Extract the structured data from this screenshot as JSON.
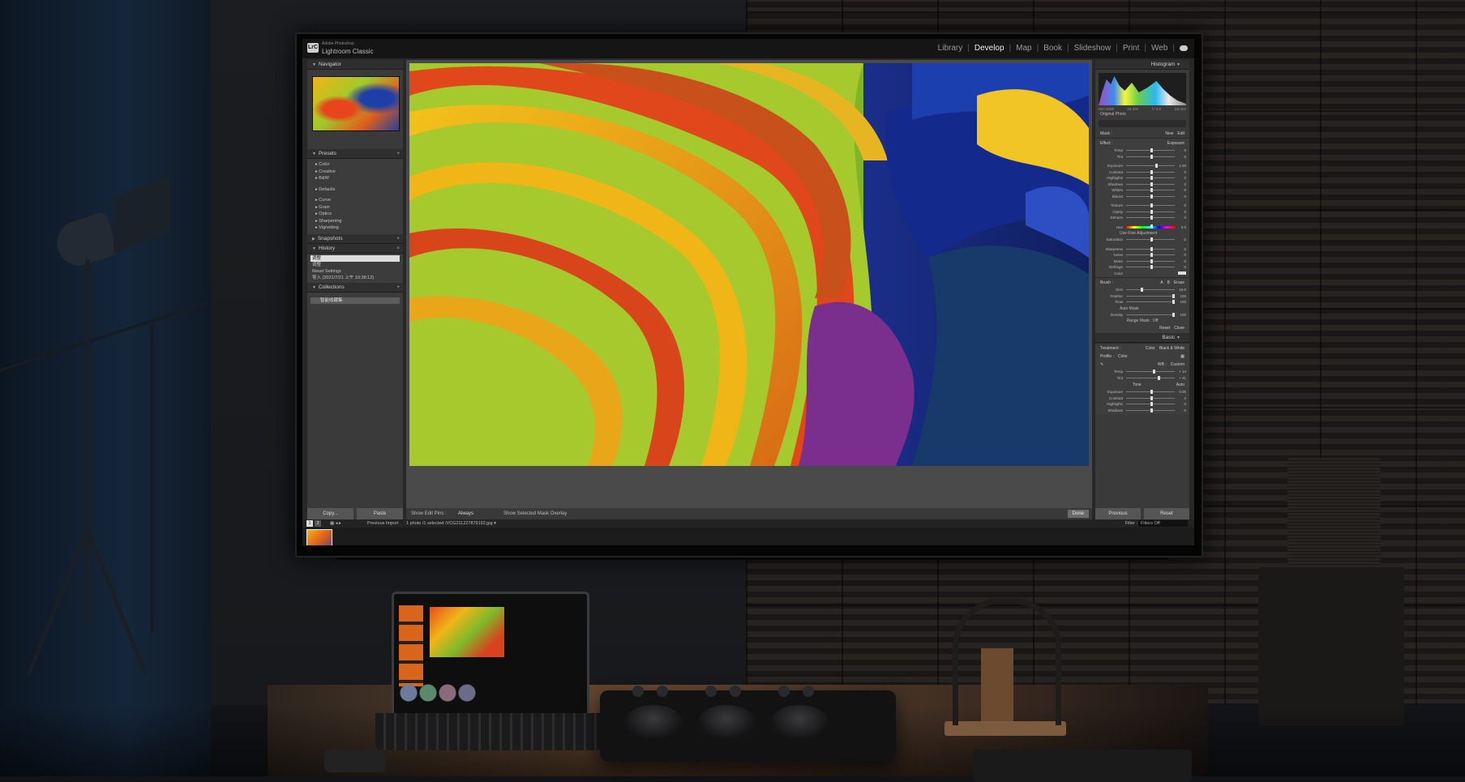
{
  "app": {
    "brand": "Adobe Photoshop",
    "name": "Lightroom Classic",
    "logo": "LrC"
  },
  "modules": [
    "Library",
    "Develop",
    "Map",
    "Book",
    "Slideshow",
    "Print",
    "Web"
  ],
  "active_module": "Develop",
  "left_panel": {
    "navigator": "Navigator",
    "presets": "Presets",
    "preset_items": [
      "Color",
      "Creative",
      "B&W",
      "Defaults",
      "Curve",
      "Grain",
      "Optics",
      "Sharpening",
      "Vignetting"
    ],
    "snapshots": "Snapshots",
    "history": "History",
    "history_items": [
      "调整",
      "调整",
      "Reset Settings",
      "导入 (2021/7/21 上午 10:38:12)"
    ],
    "collections": "Collections",
    "collection_items": [
      "智能收藏集"
    ],
    "copy_button": "Copy...",
    "paste_button": "Paste"
  },
  "center": {
    "toolbar_show_edit_pins": "Show Edit Pins :",
    "toolbar_pins_value": "Always",
    "toolbar_overlay": "Show Selected Mask Overlay",
    "done_button": "Done"
  },
  "right_panel": {
    "histogram": "Histogram",
    "histogram_info": [
      "ISO 2000",
      "24 mm",
      "f / 2.8",
      "1/6 sec"
    ],
    "original_photo": "Original Photo",
    "mask_label": "Mask :",
    "mask_new": "New",
    "mask_edit": "Edit",
    "effect_label": "Effect :",
    "effect_value": "Exposure",
    "sliders_a": [
      "Temp",
      "Tint"
    ],
    "sliders_b": [
      "Exposure",
      "Contrast",
      "Highlights",
      "Shadows",
      "Whites",
      "Blacks"
    ],
    "sliders_c": [
      "Texture",
      "Clarity",
      "Dehaze"
    ],
    "hue_label": "Hue",
    "hue_value": "0.0",
    "fine_adjust": "Use Fine Adjustment",
    "saturation": "Saturation",
    "sliders_d": [
      "Sharpness",
      "Noise",
      "Moire",
      "Defringe"
    ],
    "color_label": "Color",
    "brush_label": "Brush :",
    "brush_a": "A",
    "brush_b": "B",
    "brush_erase": "Erase",
    "brush_sliders": [
      "Size",
      "Feather",
      "Flow"
    ],
    "brush_values": [
      "15.0",
      "100",
      "100"
    ],
    "auto_mask": "Auto Mask",
    "density": "Density",
    "density_value": "100",
    "range_mask": "Range Mask : Off",
    "reset": "Reset",
    "close": "Close",
    "basic": "Basic",
    "treatment": "Treatment :",
    "treatment_color": "Color",
    "treatment_bw": "Black & White",
    "profile": "Profile :",
    "profile_value": "Color",
    "wb": "WB :",
    "wb_value": "Custom",
    "temp_tint_values": [
      "+ 14",
      "+ 41"
    ],
    "tone": "Tone",
    "tone_auto": "Auto",
    "tone_sliders": [
      "Exposure",
      "Contrast",
      "Highlights",
      "Shadows"
    ],
    "exposure_value": "0.00",
    "previous_button": "Previous",
    "reset_button": "Reset"
  },
  "filmstrip": {
    "page1": "1",
    "page2": "2",
    "source": "Previous Import",
    "selection": "1 photo /1 selected /VCG211227879192.jpg ▾",
    "filter_label": "Filter :",
    "filter_value": "Filters Off"
  },
  "colors": {
    "lr_dark": "#151515",
    "panel_bg": "#3a3a3a",
    "photo_orange": "#e2601a",
    "photo_yellow": "#f1b515",
    "photo_green": "#7fba2a",
    "photo_blue": "#1e3fa8"
  },
  "icons": [
    "lrc-logo-icon",
    "cloud-icon",
    "triangle-icon",
    "plus-icon",
    "grid-icon"
  ]
}
